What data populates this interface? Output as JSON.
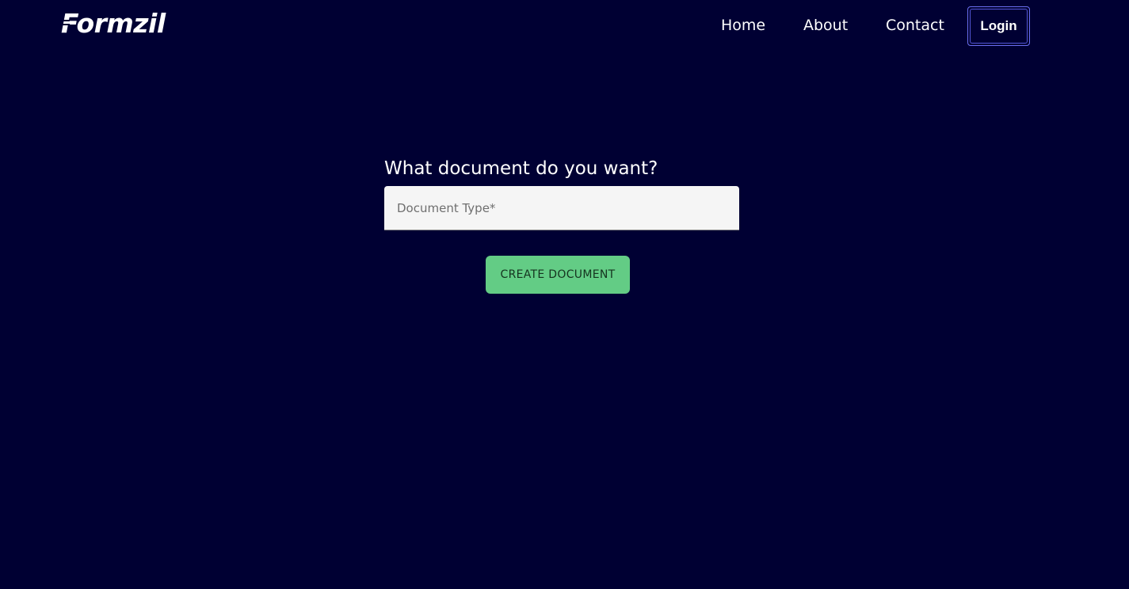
{
  "header": {
    "logo_text": "Formzil",
    "nav": {
      "home": "Home",
      "about": "About",
      "contact": "Contact"
    },
    "login_label": "Login"
  },
  "main": {
    "heading": "What document do you want?",
    "document_type_input": {
      "placeholder": "Document Type*",
      "value": ""
    },
    "create_button_label": "CREATE DOCUMENT"
  },
  "colors": {
    "background": "#000033",
    "accent_green": "#63cc85",
    "login_border": "#6b6ff0",
    "input_background": "#f5f5f5"
  }
}
